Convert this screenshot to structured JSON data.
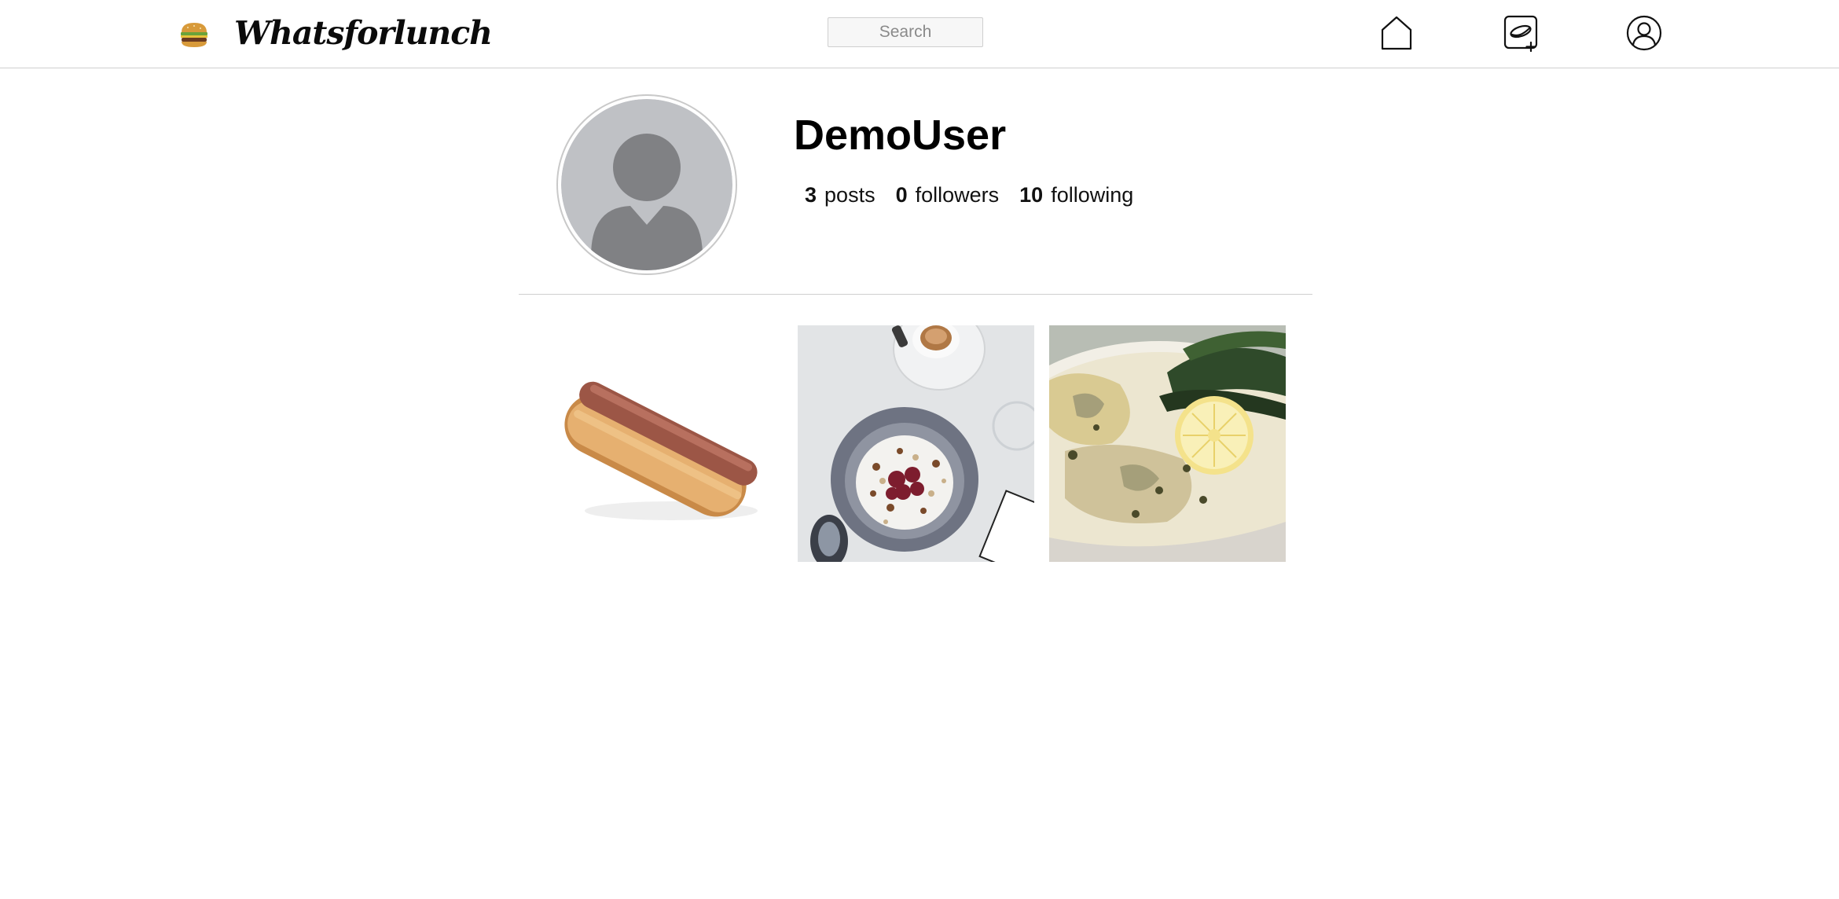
{
  "header": {
    "brand": "Whatsforlunch",
    "logo_icon": "burger-icon",
    "search": {
      "placeholder": "Search",
      "value": ""
    },
    "nav": [
      {
        "name": "home",
        "icon": "home-icon"
      },
      {
        "name": "new-post",
        "icon": "new-post-icon"
      },
      {
        "name": "profile",
        "icon": "user-circle-icon"
      }
    ]
  },
  "profile": {
    "username": "DemoUser",
    "avatar_icon": "default-avatar-icon",
    "stats": {
      "posts_count": "3",
      "posts_label": "posts",
      "followers_count": "0",
      "followers_label": "followers",
      "following_count": "10",
      "following_label": "following"
    }
  },
  "posts": [
    {
      "image": "hot-dog-photo"
    },
    {
      "image": "oatmeal-bowl-photo"
    },
    {
      "image": "fish-lemon-plate-photo"
    }
  ],
  "colors": {
    "border": "#cfcfcf",
    "avatar_bg": "#bfc1c5",
    "avatar_figure": "#808184",
    "text": "#111111"
  }
}
